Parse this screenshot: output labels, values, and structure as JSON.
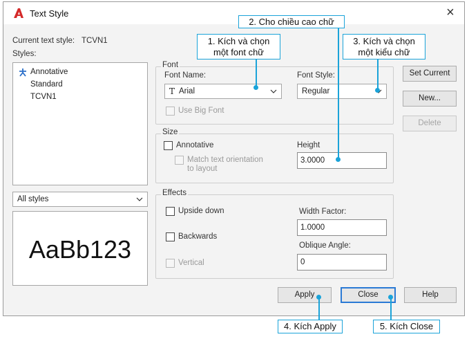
{
  "window": {
    "title": "Text Style",
    "close_icon": "×"
  },
  "current_style": {
    "label": "Current text style:",
    "value": "TCVN1"
  },
  "styles": {
    "label": "Styles:",
    "items": [
      {
        "label": "Annotative",
        "icon": "annotative-icon"
      },
      {
        "label": "Standard"
      },
      {
        "label": "TCVN1",
        "selected": true
      }
    ]
  },
  "filter": {
    "value": "All styles"
  },
  "preview": {
    "text": "AaBb123"
  },
  "font": {
    "group_label": "Font",
    "name_label": "Font Name:",
    "name_value": "Arial",
    "style_label": "Font Style:",
    "style_value": "Regular",
    "big_font_label": "Use Big Font"
  },
  "size": {
    "group_label": "Size",
    "annotative_label": "Annotative",
    "match_label_1": "Match text orientation",
    "match_label_2": "to layout",
    "height_label": "Height",
    "height_value": "3.0000"
  },
  "effects": {
    "group_label": "Effects",
    "upside_down": "Upside down",
    "backwards": "Backwards",
    "vertical": "Vertical",
    "width_factor_label": "Width Factor:",
    "width_factor_value": "1.0000",
    "oblique_label": "Oblique Angle:",
    "oblique_value": "0"
  },
  "buttons": {
    "set_current": "Set Current",
    "new": "New...",
    "delete": "Delete",
    "apply": "Apply",
    "close": "Close",
    "help": "Help"
  },
  "callouts": {
    "c1_line1": "1. Kích và chọn",
    "c1_line2": "một font chữ",
    "c2": "2. Cho chiều cao chữ",
    "c3_line1": "3. Kích và chọn",
    "c3_line2": "một kiểu chữ",
    "c4": "4. Kích Apply",
    "c5": "5. Kích Close"
  },
  "colors": {
    "callout": "#1aa3d9",
    "autocad_red": "#d42a2a",
    "default_button": "#2a7ad5"
  }
}
